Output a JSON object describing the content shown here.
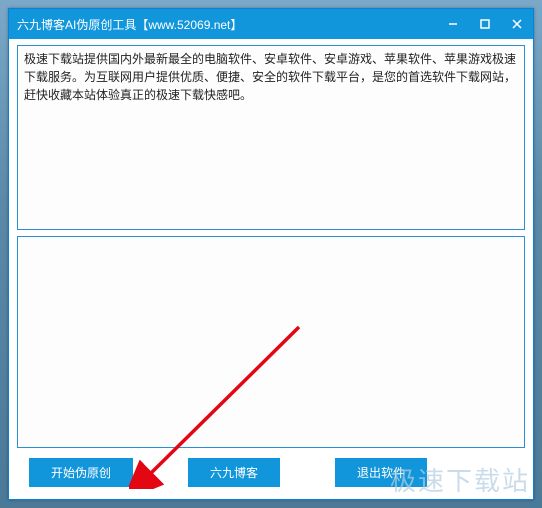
{
  "window": {
    "title": "六九博客AI伪原创工具【www.52069.net】"
  },
  "input": {
    "text": "极速下载站提供国内外最新最全的电脑软件、安卓软件、安卓游戏、苹果软件、苹果游戏极速下载服务。为互联网用户提供优质、便捷、安全的软件下载平台，是您的首选软件下载网站，赶快收藏本站体验真正的极速下载快感吧。"
  },
  "output": {
    "text": ""
  },
  "buttons": {
    "start": "开始伪原创",
    "blog": "六九博客",
    "exit": "退出软件"
  },
  "watermark": "极速下载站"
}
